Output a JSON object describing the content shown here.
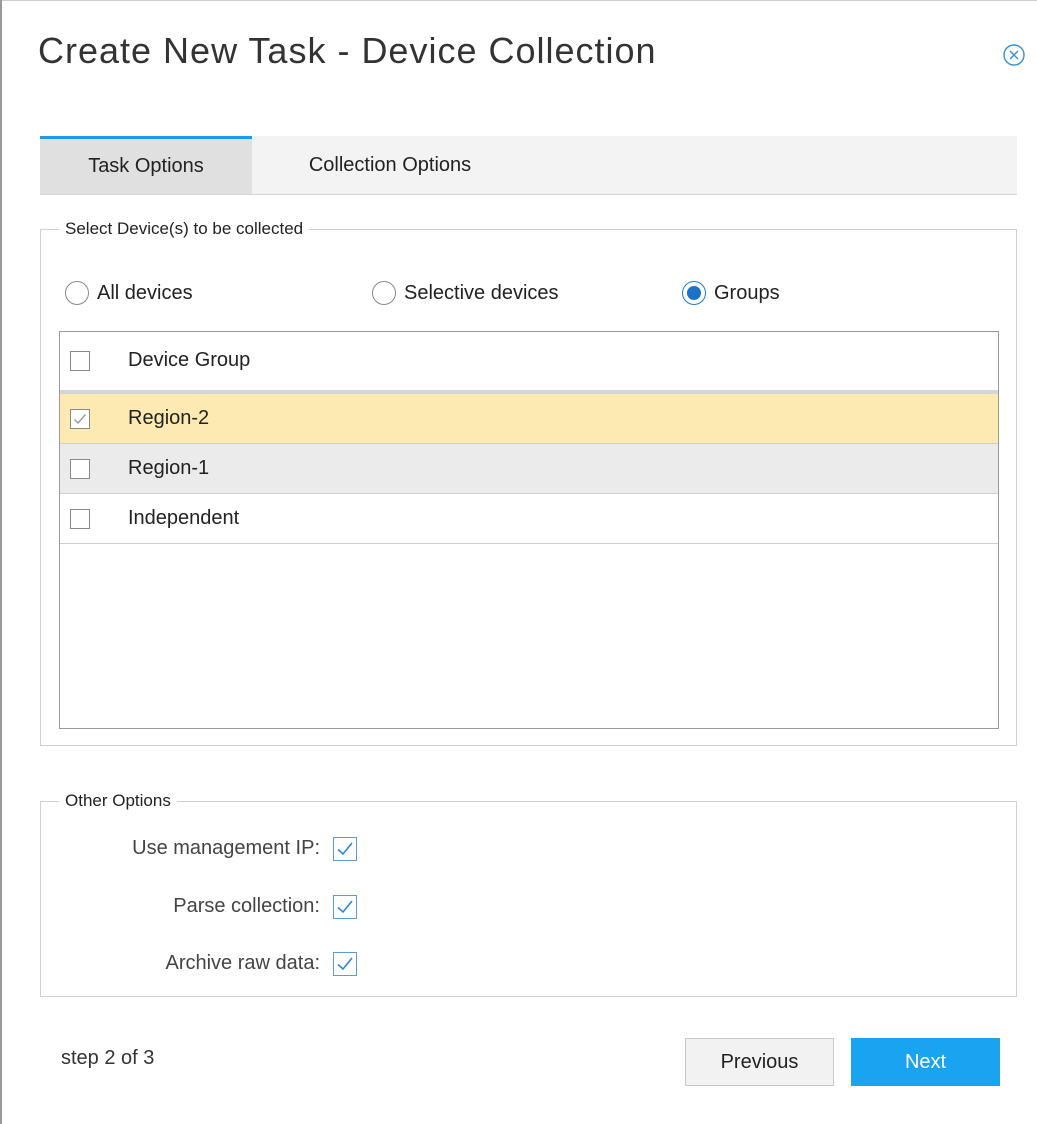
{
  "dialog": {
    "title": "Create New Task - Device Collection",
    "close_icon": "close-circle-icon"
  },
  "tabs": [
    {
      "label": "Task Options",
      "active": true
    },
    {
      "label": "Collection Options",
      "active": false
    }
  ],
  "devices_section": {
    "legend": "Select Device(s) to be collected",
    "radios": [
      {
        "label": "All devices",
        "checked": false
      },
      {
        "label": "Selective devices",
        "checked": false
      },
      {
        "label": "Groups",
        "checked": true
      }
    ],
    "grid": {
      "header": {
        "label": "Device Group",
        "checked": false
      },
      "rows": [
        {
          "label": "Region-2",
          "checked": true,
          "state": "selected"
        },
        {
          "label": "Region-1",
          "checked": false,
          "state": "hover"
        },
        {
          "label": "Independent",
          "checked": false,
          "state": "normal"
        }
      ]
    }
  },
  "other_options": {
    "legend": "Other Options",
    "items": [
      {
        "label": "Use management IP:",
        "checked": true
      },
      {
        "label": "Parse collection:",
        "checked": true
      },
      {
        "label": "Archive raw data:",
        "checked": true
      }
    ]
  },
  "footer": {
    "step": "step 2 of 3",
    "previous_label": "Previous",
    "next_label": "Next"
  },
  "colors": {
    "accent": "#1aa3f0",
    "selected_row": "#fdeab2",
    "alt_row": "#ebebeb",
    "tab_active": "#e0e0e0"
  }
}
